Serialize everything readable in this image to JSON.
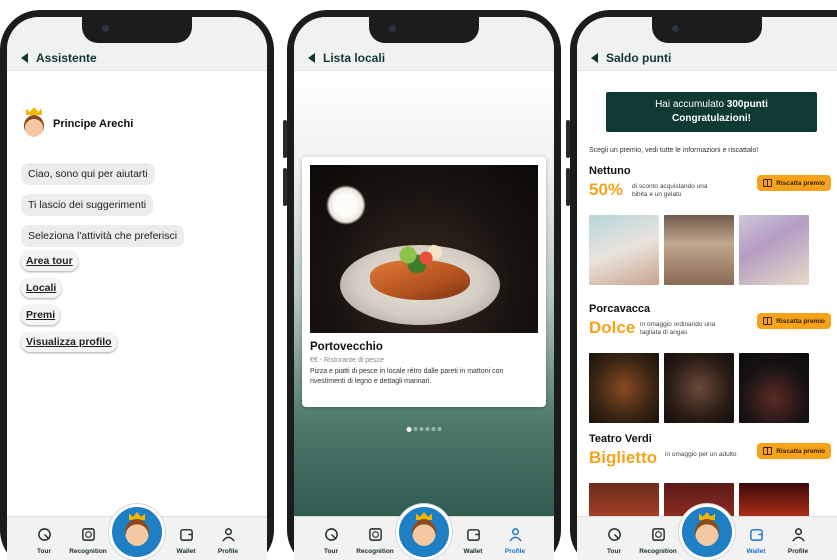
{
  "tabbar": {
    "tabs": [
      "Tour",
      "Recognition",
      "Wallet",
      "Profile"
    ]
  },
  "assistant": {
    "title": "Assistente",
    "name": "Principe Arechi",
    "messages": [
      "Ciao, sono qui per aiutarti",
      "Ti lascio dei suggerimenti",
      "Seleziona l'attività che preferisci"
    ],
    "choices": [
      "Area tour",
      "Locali",
      "Premi",
      "Visualizza profilo"
    ]
  },
  "venues": {
    "title": "Lista locali",
    "card": {
      "name": "Portovecchio",
      "subtitle": "€€ - Ristorante di pesce",
      "description": "Pizza e piatti di pesce in locale rétro dalle pareti in mattoni con rivestimenti di legno e dettagli marinari."
    },
    "page_count": 6,
    "active_page": 1
  },
  "points": {
    "title": "Saldo punti",
    "banner_line1_prefix": "Hai accumulato ",
    "banner_points": "300punti",
    "banner_line2": "Congratulazioni!",
    "instruction": "Scegli un premio, vedi tutte le informazioni e riscattalo!",
    "redeem_label": "Riscatta premio",
    "rewards": [
      {
        "name": "Nettuno",
        "highlight": "50%",
        "description": "di sconto acquistando una bibita e un gelato"
      },
      {
        "name": "Porcavacca",
        "highlight": "Dolce",
        "description": "in omaggio ordinando una tagliata di angas"
      },
      {
        "name": "Teatro Verdi",
        "highlight": "Biglietto",
        "description": "in omaggio per un adulto"
      }
    ]
  },
  "colors": {
    "brand_dark_green": "#0e3a33",
    "accent_orange": "#f6a31a",
    "active_tab_blue": "#1a73c8",
    "center_button_blue": "#1e7fc4"
  }
}
